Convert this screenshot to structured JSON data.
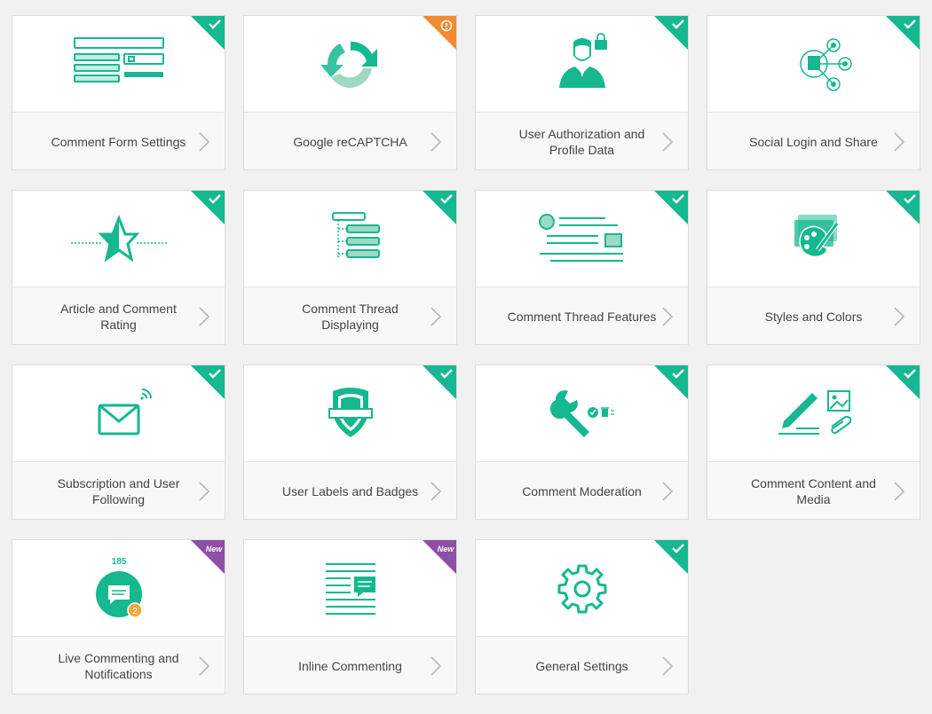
{
  "colors": {
    "accent": "#15b88f",
    "warning": "#f28b2e",
    "new": "#8e4fa6",
    "chevron": "#b8b8b8"
  },
  "cards": [
    {
      "title": "Comment Form Settings",
      "icon": "form-layout-icon",
      "status": "check"
    },
    {
      "title": "Google reCAPTCHA",
      "icon": "recaptcha-icon",
      "status": "warning"
    },
    {
      "title": "User Authorization and Profile Data",
      "icon": "user-lock-icon",
      "status": "check"
    },
    {
      "title": "Social Login and Share",
      "icon": "social-network-icon",
      "status": "check"
    },
    {
      "title": "Article and Comment Rating",
      "icon": "star-rating-icon",
      "status": "check"
    },
    {
      "title": "Comment Thread Displaying",
      "icon": "thread-tree-icon",
      "status": "check"
    },
    {
      "title": "Comment Thread Features",
      "icon": "thread-features-icon",
      "status": "check"
    },
    {
      "title": "Styles and Colors",
      "icon": "palette-icon",
      "status": "check"
    },
    {
      "title": "Subscription and User Following",
      "icon": "envelope-icon",
      "status": "check"
    },
    {
      "title": "User Labels and Badges",
      "icon": "shield-badge-icon",
      "status": "check"
    },
    {
      "title": "Comment Moderation",
      "icon": "wrench-icon",
      "status": "check"
    },
    {
      "title": "Comment Content and Media",
      "icon": "pencil-media-icon",
      "status": "check"
    },
    {
      "title": "Live Commenting and Notifications",
      "icon": "live-chat-icon",
      "status": "new",
      "badge_text": "New",
      "count": "185",
      "notif": "2"
    },
    {
      "title": "Inline Commenting",
      "icon": "inline-comment-icon",
      "status": "new",
      "badge_text": "New"
    },
    {
      "title": "General Settings",
      "icon": "gear-icon",
      "status": "check"
    }
  ]
}
